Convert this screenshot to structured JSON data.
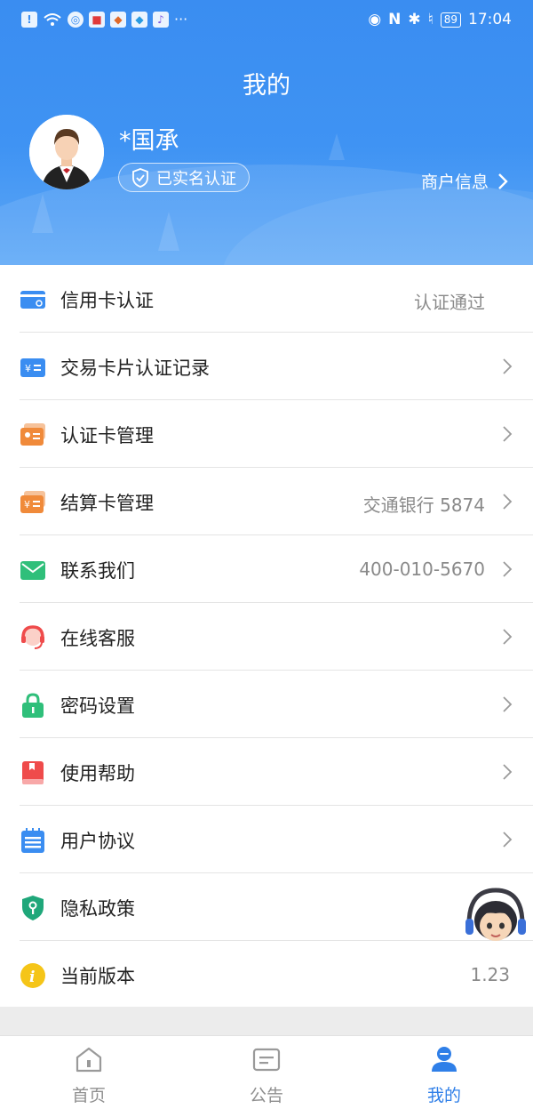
{
  "status_bar": {
    "time": "17:04",
    "battery": "89"
  },
  "header": {
    "title": "我的",
    "username": "*国承",
    "verified_label": "已实名认证",
    "merchant_label": "商户信息"
  },
  "menu": [
    {
      "label": "信用卡认证",
      "value": "认证通过",
      "icon": "credit-card-icon",
      "color": "#3a8df1"
    },
    {
      "label": "交易卡片认证记录",
      "value": "",
      "icon": "transaction-card-icon",
      "color": "#3a8df1"
    },
    {
      "label": "认证卡管理",
      "value": "",
      "icon": "auth-card-icon",
      "color": "#f08a3a"
    },
    {
      "label": "结算卡管理",
      "value": "交通银行 5874",
      "icon": "settlement-card-icon",
      "color": "#f08a3a"
    },
    {
      "label": "联系我们",
      "value": "400-010-5670",
      "icon": "mail-icon",
      "color": "#2fbf7a"
    },
    {
      "label": "在线客服",
      "value": "",
      "icon": "headset-icon",
      "color": "#ef4b4b"
    },
    {
      "label": "密码设置",
      "value": "",
      "icon": "lock-icon",
      "color": "#2fbf7a"
    },
    {
      "label": "使用帮助",
      "value": "",
      "icon": "help-book-icon",
      "color": "#ef4b4b"
    },
    {
      "label": "用户协议",
      "value": "",
      "icon": "agreement-icon",
      "color": "#3a8df1"
    },
    {
      "label": "隐私政策",
      "value": "",
      "icon": "privacy-shield-icon",
      "color": "#1fa77a"
    },
    {
      "label": "当前版本",
      "value": "1.23",
      "icon": "info-icon",
      "color": "#f5c518"
    }
  ],
  "tabs": [
    {
      "label": "首页",
      "icon": "home-icon"
    },
    {
      "label": "公告",
      "icon": "notice-icon"
    },
    {
      "label": "我的",
      "icon": "profile-icon"
    }
  ],
  "colors": {
    "accent": "#3a8df1",
    "active_tab": "#2f7fe8"
  }
}
